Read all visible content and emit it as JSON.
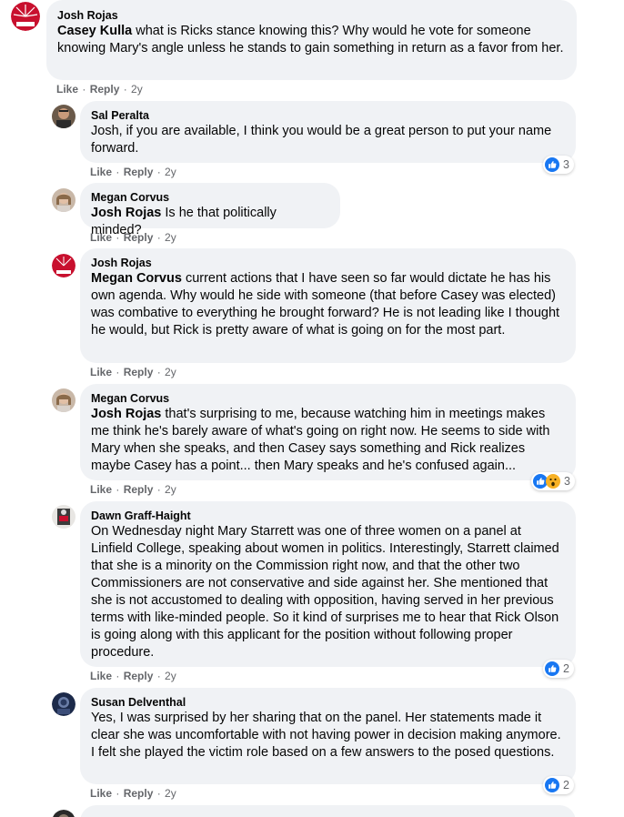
{
  "comments": [
    {
      "author": "Josh Rojas",
      "mention": "Casey Kulla",
      "text": " what is Ricks stance knowing this? Why would he vote for someone knowing Mary's angle unless he stands to gain something in return as a favor from her.",
      "like": "Like",
      "reply": "Reply",
      "time": "2y"
    },
    {
      "author": "Sal Peralta",
      "mention": "",
      "text": "Josh, if you are available, I think you would be a great person to put your name forward.",
      "like": "Like",
      "reply": "Reply",
      "time": "2y",
      "reaction_count": "3"
    },
    {
      "author": "Megan Corvus",
      "mention": "Josh Rojas",
      "text": " Is he that politically minded?",
      "like": "Like",
      "reply": "Reply",
      "time": "2y"
    },
    {
      "author": "Josh Rojas",
      "mention": "Megan Corvus",
      "text": " current actions that I have seen so far would dictate he has his own agenda. Why would he side with someone (that before Casey was elected) was combative to everything he brought forward? He is not leading like I thought he would, but Rick is pretty aware of what is going on for the most part.",
      "like": "Like",
      "reply": "Reply",
      "time": "2y"
    },
    {
      "author": "Megan Corvus",
      "mention": "Josh Rojas",
      "text": " that's surprising to me, because watching him in meetings makes me think he's barely aware of what's going on right now. He seems to side with Mary when she speaks, and then Casey says something and Rick realizes maybe Casey has a point... then Mary speaks and he's confused again...",
      "like": "Like",
      "reply": "Reply",
      "time": "2y",
      "reaction_count": "3"
    },
    {
      "author": "Dawn Graff-Haight",
      "mention": "",
      "text": "On Wednesday night Mary Starrett was one of three women on a panel at Linfield College, speaking about women in politics. Interestingly, Starrett claimed that she is a minority on the Commission right now, and that the other two Commissioners are not conservative and side against her. She mentioned that she is not accustomed to dealing with opposition, having served in her previous terms with like-minded people. So it kind of surprises me to hear that Rick Olson is going along with this applicant for the position without following proper procedure.",
      "like": "Like",
      "reply": "Reply",
      "time": "2y",
      "reaction_count": "2"
    },
    {
      "author": "Susan Delventhal",
      "mention": "",
      "text": "Yes, I was surprised by her sharing that on the panel. Her statements made it clear she was uncomfortable with not having power in decision making anymore. I felt she played the victim role based on a few answers to the posed questions.",
      "like": "Like",
      "reply": "Reply",
      "time": "2y",
      "reaction_count": "2"
    }
  ],
  "colors": {
    "bubble": "#f0f2f5",
    "meta": "#65676b",
    "like_blue": "#1877f2",
    "wow_yellow": "#f7b125"
  }
}
